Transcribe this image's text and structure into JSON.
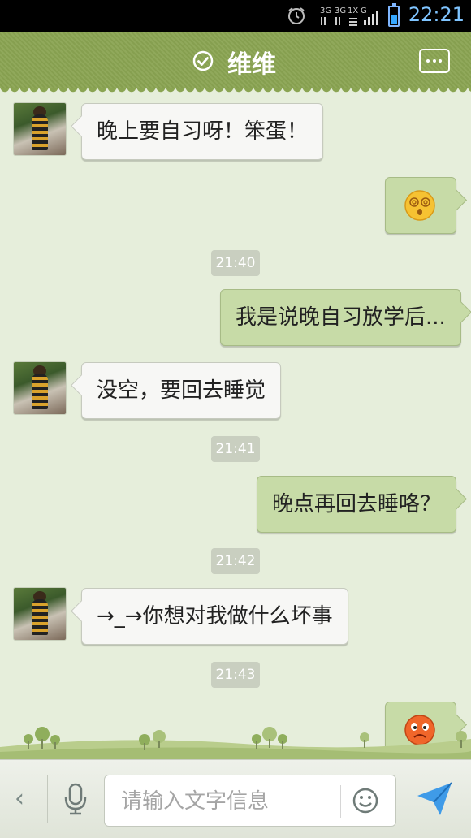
{
  "status_bar": {
    "time": "22:21",
    "network_labels": [
      "3G",
      "3G",
      "1X",
      "G"
    ],
    "icons": [
      "alarm-clock-icon",
      "signal-bars-icon",
      "battery-icon"
    ]
  },
  "header": {
    "title": "维维",
    "online_icon": "check-circle-icon",
    "menu_icon": "more-dots-icon"
  },
  "messages": [
    {
      "side": "left",
      "type": "text",
      "text": "晚上要自习呀！笨蛋！"
    },
    {
      "side": "right",
      "type": "emoji",
      "icon": "dizzy-face-icon"
    },
    {
      "type": "time",
      "text": "21:40"
    },
    {
      "side": "right",
      "type": "text",
      "text": "我是说晚自习放学后..."
    },
    {
      "side": "left",
      "type": "text",
      "text": "没空，要回去睡觉"
    },
    {
      "type": "time",
      "text": "21:41"
    },
    {
      "side": "right",
      "type": "text",
      "text": "晚点再回去睡咯？"
    },
    {
      "type": "time",
      "text": "21:42"
    },
    {
      "side": "left",
      "type": "text",
      "text": "→_→你想对我做什么坏事"
    },
    {
      "type": "time",
      "text": "21:43"
    },
    {
      "side": "right",
      "type": "emoji",
      "icon": "angry-face-icon"
    }
  ],
  "input_bar": {
    "placeholder": "请输入文字信息",
    "value": "",
    "back_glyph": "‹",
    "icons": [
      "mic-icon",
      "smiley-icon",
      "send-icon"
    ]
  },
  "colors": {
    "header_green": "#8aa452",
    "chat_bg": "#e6eedb",
    "bubble_out": "#c7dba7",
    "bubble_in": "#f7f7f5",
    "clock_blue": "#7fc4ff"
  }
}
